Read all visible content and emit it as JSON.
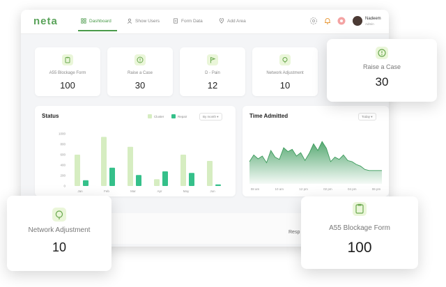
{
  "app": {
    "logo": "neta"
  },
  "nav": [
    {
      "label": "Dashboard",
      "icon": "grid-icon",
      "active": true
    },
    {
      "label": "Show Users",
      "icon": "user-icon",
      "active": false
    },
    {
      "label": "Form Data",
      "icon": "document-icon",
      "active": false
    },
    {
      "label": "Add Area",
      "icon": "location-pin-icon",
      "active": false
    }
  ],
  "user": {
    "name": "Nadeem",
    "role": "Admin"
  },
  "cards": [
    {
      "label": "A55 Blockage Form",
      "value": "100",
      "icon": "clipboard-icon"
    },
    {
      "label": "Raise a Case",
      "value": "30",
      "icon": "alert-circle-icon"
    },
    {
      "label": "D - Pain",
      "value": "12",
      "icon": "flag-icon"
    },
    {
      "label": "Network Adjustment",
      "value": "10",
      "icon": "network-icon"
    }
  ],
  "status_panel": {
    "title": "Status",
    "legend": [
      "Cluster",
      "Repair"
    ],
    "dropdown": "By month"
  },
  "time_panel": {
    "title": "Time Admitted",
    "dropdown": "Today"
  },
  "float_cards": {
    "raise_case": {
      "label": "Raise a Case",
      "value": "30"
    },
    "network": {
      "label": "Network Adjustment",
      "value": "10"
    },
    "blockage": {
      "label": "A55 Blockage Form",
      "value": "100"
    }
  },
  "bottom": {
    "resp_label": "Resp"
  },
  "colors": {
    "accent": "#4a9a4a",
    "light_bar": "#d6edc1",
    "dark_bar": "#35c08a",
    "area": "#3a9a5a"
  },
  "chart_data": [
    {
      "type": "bar",
      "title": "Status",
      "categories": [
        "Jan",
        "Feb",
        "Mar",
        "Apr",
        "May",
        "Jun"
      ],
      "yticks": [
        "1000",
        "800",
        "600",
        "400",
        "200",
        "0"
      ],
      "ylim": [
        0,
        1000
      ],
      "series": [
        {
          "name": "Cluster",
          "values": [
            600,
            940,
            750,
            130,
            600,
            480
          ]
        },
        {
          "name": "Repair",
          "values": [
            110,
            350,
            210,
            280,
            250,
            30
          ]
        }
      ],
      "legend_position": "top-right",
      "grid": false
    },
    {
      "type": "area",
      "title": "Time Admitted",
      "x_labels": [
        "08 am",
        "10 am",
        "12 pm",
        "02 pm",
        "04 pm",
        "06 pm"
      ],
      "y": [
        40,
        52,
        45,
        50,
        38,
        60,
        48,
        44,
        65,
        58,
        62,
        50,
        56,
        42,
        55,
        72,
        60,
        76,
        64,
        40,
        48,
        44,
        52,
        42,
        40,
        35,
        32,
        26,
        24,
        24,
        24,
        24
      ],
      "ylim": [
        0,
        100
      ],
      "grid": false
    }
  ]
}
